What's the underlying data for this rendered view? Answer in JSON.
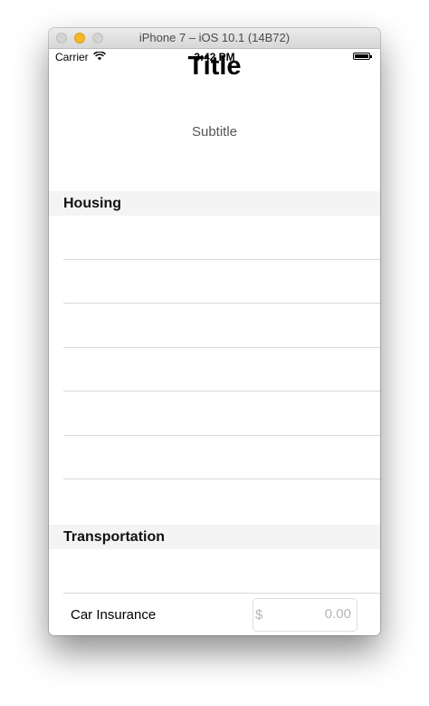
{
  "window": {
    "title": "iPhone 7 – iOS 10.1 (14B72)"
  },
  "statusbar": {
    "carrier": "Carrier",
    "time": "3:42 PM"
  },
  "header": {
    "title": "Title",
    "subtitle": "Subtitle"
  },
  "sections": [
    {
      "title": "Housing"
    },
    {
      "title": "Transportation"
    }
  ],
  "rows": [
    {
      "label": "Car Insurance",
      "currency": "$",
      "placeholder": "0.00"
    }
  ],
  "colors": {
    "minimize": "#f5b62a",
    "section_background": "#f4f4f4"
  }
}
